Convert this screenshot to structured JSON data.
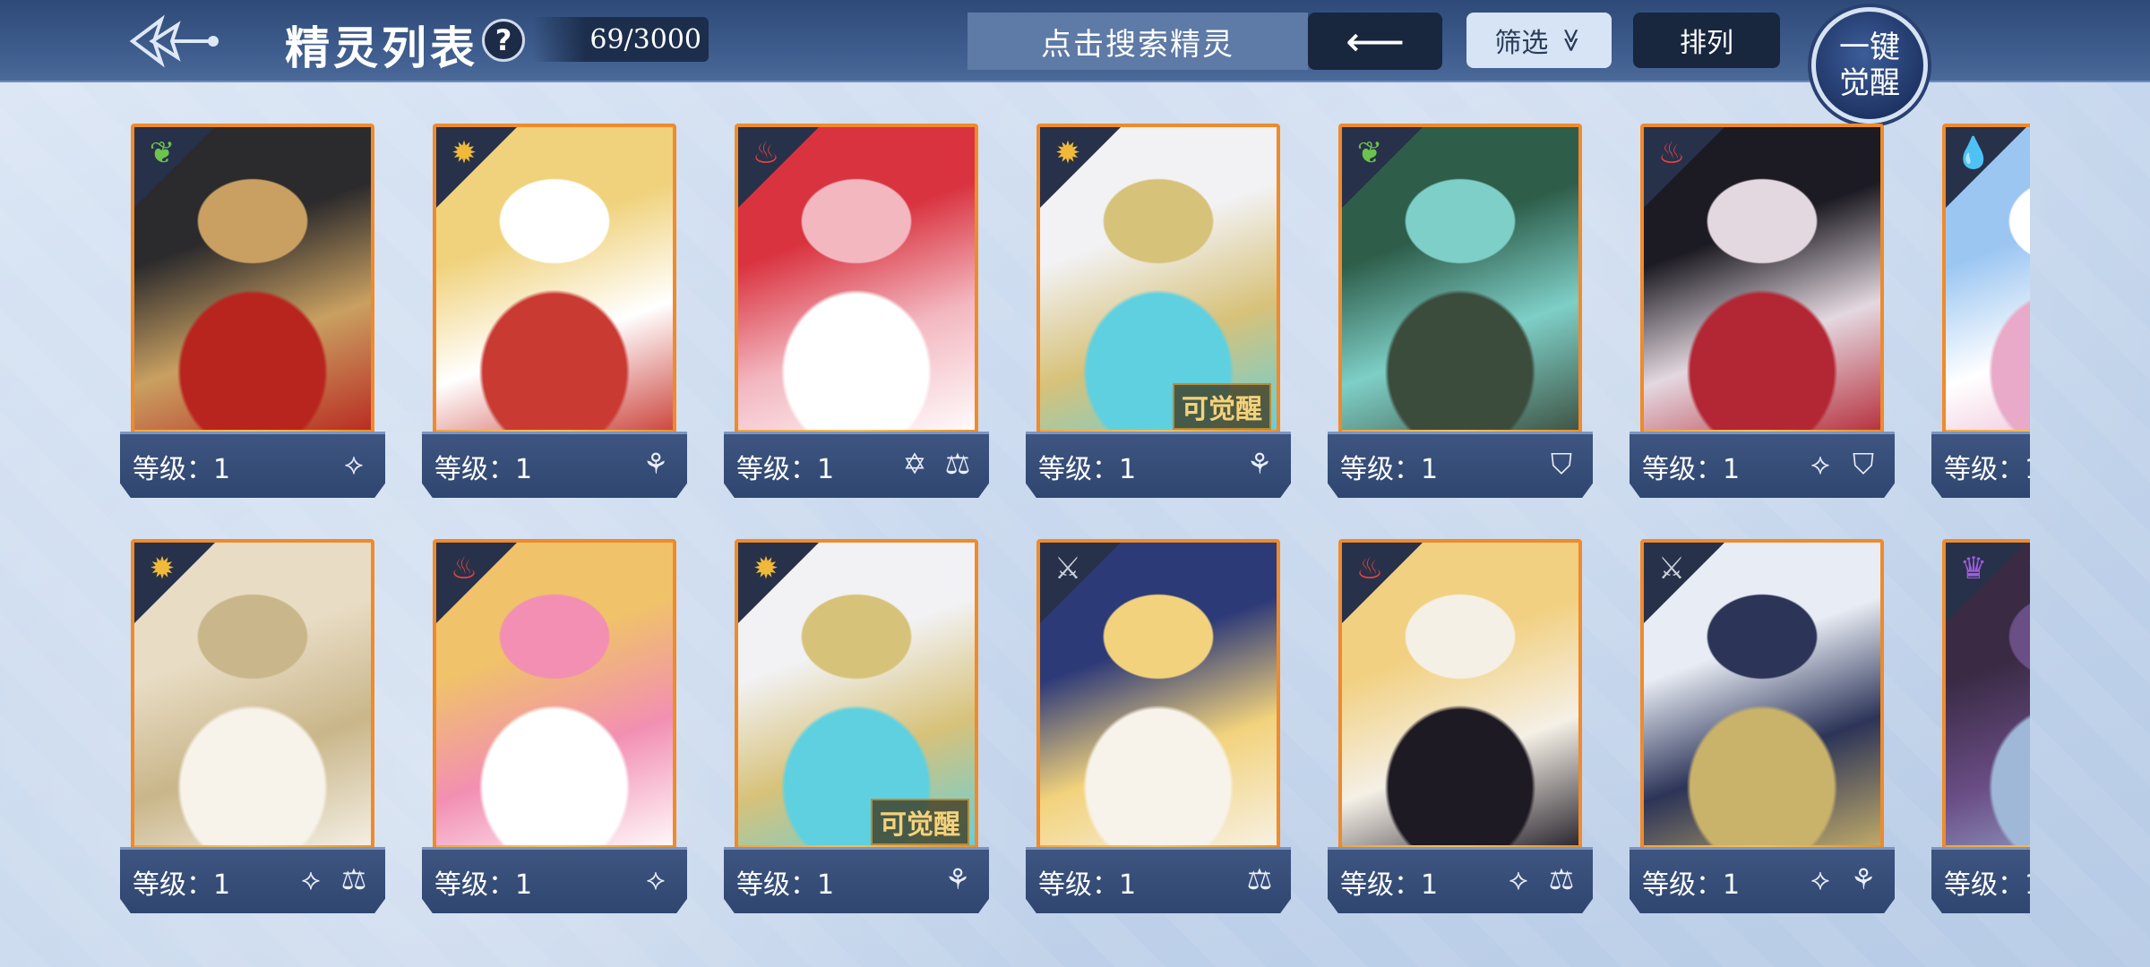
{
  "header": {
    "title": "精灵列表",
    "help_label": "?",
    "count": "69/3000",
    "search_placeholder": "点击搜索精灵",
    "back_label": "⟵",
    "filter_label": "筛选",
    "filter_chevron": "≫",
    "sort_label": "排列",
    "awaken_line1": "一键",
    "awaken_line2": "觉醒"
  },
  "level_label": "等级：1",
  "awaken_tag": "可觉醒",
  "colors": {
    "fire": "#e8433d",
    "light": "#f0b93a",
    "wood": "#6cc34d",
    "water": "#3b8de8",
    "neutral": "#c9d0dc",
    "dark": "#a05ae0",
    "frame": "#f08a2a"
  },
  "cards": [
    {
      "element": "wood-icon",
      "glyph": "❦",
      "color_key": "wood",
      "awaken": false,
      "skills": [
        "claw-icon"
      ],
      "art": [
        "#2b2a2c",
        "#c9a061",
        "#b8241e"
      ]
    },
    {
      "element": "sun-icon",
      "glyph": "✹",
      "color_key": "light",
      "awaken": false,
      "skills": [
        "book-icon"
      ],
      "art": [
        "#f0d27c",
        "#ffffff",
        "#c93a32"
      ]
    },
    {
      "element": "fire-icon",
      "glyph": "♨",
      "color_key": "fire",
      "awaken": false,
      "skills": [
        "star-icon",
        "scale-icon"
      ],
      "art": [
        "#d9333f",
        "#f3b7c0",
        "#ffffff"
      ]
    },
    {
      "element": "sun-icon",
      "glyph": "✹",
      "color_key": "light",
      "awaken": true,
      "skills": [
        "book-icon"
      ],
      "art": [
        "#f2f2f4",
        "#d7c27a",
        "#5fd0e0"
      ]
    },
    {
      "element": "wood-icon",
      "glyph": "❦",
      "color_key": "wood",
      "awaken": false,
      "skills": [
        "shield-icon"
      ],
      "art": [
        "#2e5d4a",
        "#7ecfc7",
        "#3b4c3c"
      ]
    },
    {
      "element": "fire-icon",
      "glyph": "♨",
      "color_key": "fire",
      "awaken": false,
      "skills": [
        "claw-icon",
        "shield-icon"
      ],
      "art": [
        "#1c1a22",
        "#e4d8e0",
        "#b32633"
      ]
    },
    {
      "element": "water-icon",
      "glyph": "💧",
      "color_key": "water",
      "awaken": false,
      "skills": [],
      "art": [
        "#9bc6f2",
        "#ffffff",
        "#e9a9c8"
      ]
    },
    {
      "element": "sun-icon",
      "glyph": "✹",
      "color_key": "light",
      "awaken": false,
      "skills": [
        "claw-icon",
        "scale-icon"
      ],
      "art": [
        "#e8dcc4",
        "#c9b68a",
        "#f7f3ea"
      ]
    },
    {
      "element": "fire-icon",
      "glyph": "♨",
      "color_key": "fire",
      "awaken": false,
      "skills": [
        "claw-icon"
      ],
      "art": [
        "#f0c26a",
        "#f28fb2",
        "#ffffff"
      ]
    },
    {
      "element": "sun-icon",
      "glyph": "✹",
      "color_key": "light",
      "awaken": true,
      "skills": [
        "book-icon"
      ],
      "art": [
        "#f2f2f4",
        "#d7c27a",
        "#5fd0e0"
      ]
    },
    {
      "element": "neutral-icon",
      "glyph": "⚔",
      "color_key": "neutral",
      "awaken": false,
      "skills": [
        "scale-icon"
      ],
      "art": [
        "#2d3a78",
        "#f2d27c",
        "#f7f3ea"
      ]
    },
    {
      "element": "fire-icon",
      "glyph": "♨",
      "color_key": "fire",
      "awaken": false,
      "skills": [
        "claw-icon",
        "scale-icon"
      ],
      "art": [
        "#f1d081",
        "#f5f0e6",
        "#1e1a24"
      ]
    },
    {
      "element": "neutral-icon",
      "glyph": "⚔",
      "color_key": "neutral",
      "awaken": false,
      "skills": [
        "claw-icon",
        "book-icon"
      ],
      "art": [
        "#e8ecf4",
        "#2c3458",
        "#c9b26a"
      ]
    },
    {
      "element": "dark-icon",
      "glyph": "♛",
      "color_key": "dark",
      "awaken": false,
      "skills": [],
      "art": [
        "#3a2a44",
        "#6a4e86",
        "#9fb8d8"
      ]
    }
  ],
  "skill_glyphs": {
    "claw-icon": "⟡",
    "book-icon": "⚘",
    "star-icon": "✡",
    "scale-icon": "⚖",
    "shield-icon": "⛉"
  }
}
